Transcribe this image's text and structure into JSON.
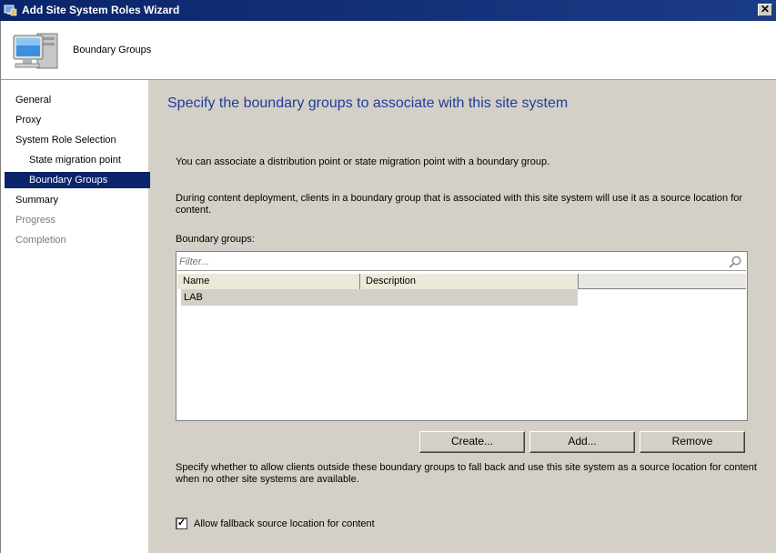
{
  "window": {
    "title": "Add Site System Roles Wizard",
    "close_glyph": "✕"
  },
  "header": {
    "title": "Boundary Groups"
  },
  "sidebar": {
    "items": [
      {
        "label": "General",
        "state": "normal"
      },
      {
        "label": "Proxy",
        "state": "normal"
      },
      {
        "label": "System Role Selection",
        "state": "normal"
      },
      {
        "label": "State migration point",
        "state": "normal"
      },
      {
        "label": "Boundary Groups",
        "state": "active"
      },
      {
        "label": "Summary",
        "state": "normal"
      },
      {
        "label": "Progress",
        "state": "disabled"
      },
      {
        "label": "Completion",
        "state": "disabled"
      }
    ]
  },
  "main": {
    "heading": "Specify the boundary groups to associate with this site system",
    "intro": "You can associate a distribution point or state migration point with a boundary group.",
    "description": "During content deployment, clients in a boundary group that is associated with this site system will use it as a source location for content.",
    "list_label": "Boundary groups:",
    "filter_placeholder": "Filter...",
    "columns": [
      "Name",
      "Description"
    ],
    "rows": [
      {
        "name": "LAB",
        "description": ""
      }
    ],
    "buttons": {
      "create": "Create...",
      "add": "Add...",
      "remove": "Remove"
    },
    "fallback_text": "Specify whether to allow clients outside these boundary groups to fall back and use this site system as a source location for content when no other site systems are available.",
    "fallback_checkbox": {
      "label": "Allow fallback source location for content",
      "checked": true,
      "glyph": "✓"
    }
  },
  "colors": {
    "title_bar": "#0a246a",
    "heading": "#1f3c9a",
    "selected_nav": "#0a246a",
    "panel": "#d4d0c8"
  }
}
